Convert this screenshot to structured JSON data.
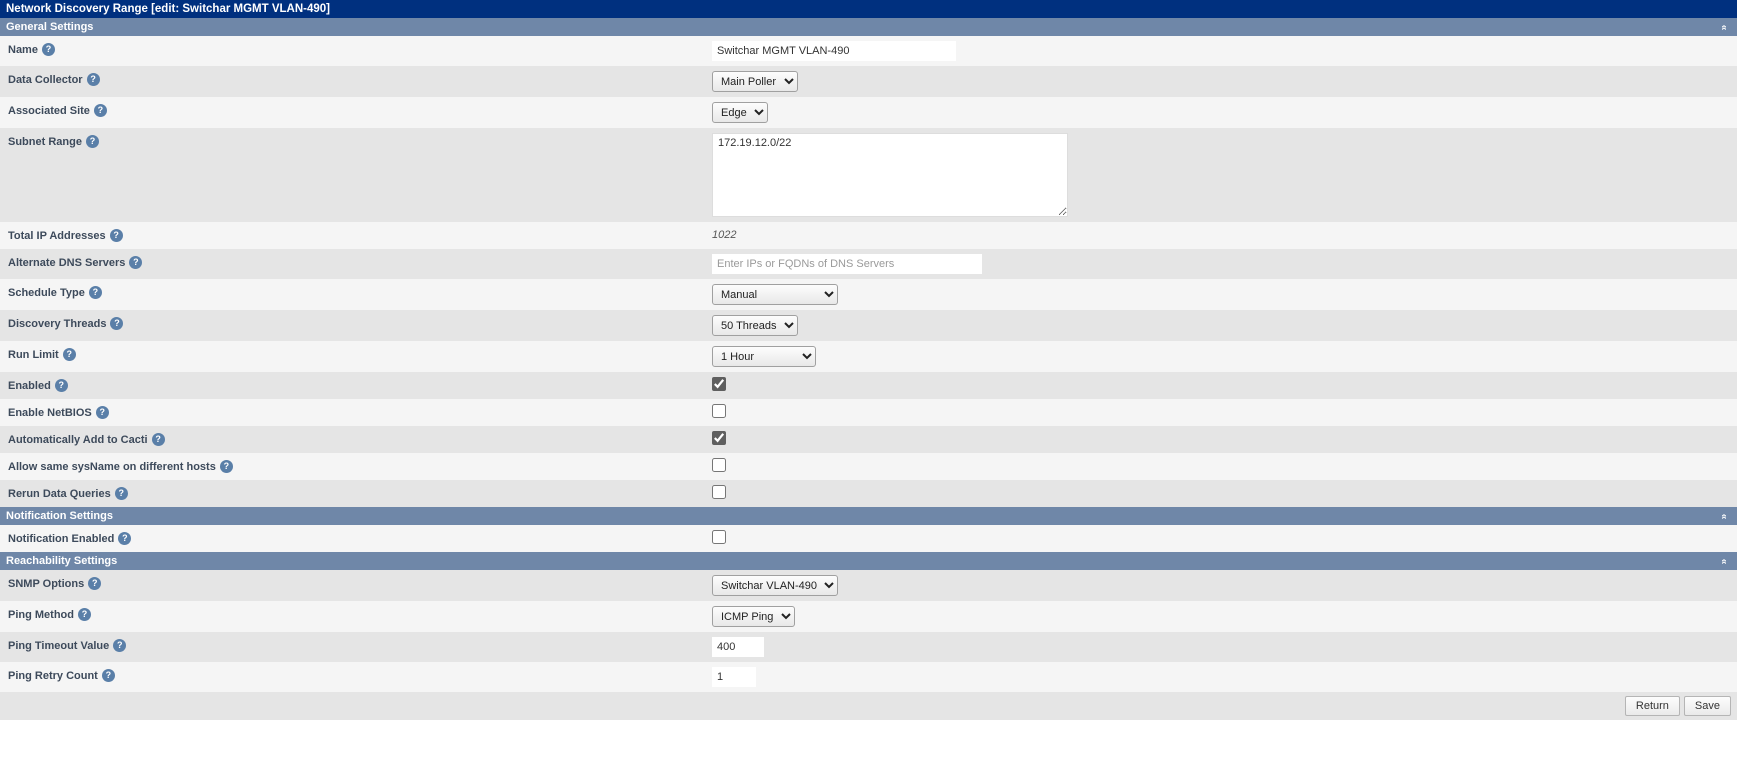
{
  "header": {
    "title": "Network Discovery Range [edit: Switchar MGMT VLAN-490]"
  },
  "sections": {
    "general": {
      "title": "General Settings",
      "fields": {
        "name": {
          "label": "Name",
          "value": "Switchar MGMT VLAN-490"
        },
        "data_collector": {
          "label": "Data Collector",
          "value": "Main Poller"
        },
        "associated_site": {
          "label": "Associated Site",
          "value": "Edge"
        },
        "subnet_range": {
          "label": "Subnet Range",
          "value": "172.19.12.0/22"
        },
        "total_ip": {
          "label": "Total IP Addresses",
          "value": "1022"
        },
        "alt_dns": {
          "label": "Alternate DNS Servers",
          "value": "",
          "placeholder": "Enter IPs or FQDNs of DNS Servers"
        },
        "schedule_type": {
          "label": "Schedule Type",
          "value": "Manual"
        },
        "discovery_threads": {
          "label": "Discovery Threads",
          "value": "50 Threads"
        },
        "run_limit": {
          "label": "Run Limit",
          "value": "1 Hour"
        },
        "enabled": {
          "label": "Enabled",
          "checked": true
        },
        "enable_netbios": {
          "label": "Enable NetBIOS",
          "checked": false
        },
        "auto_add": {
          "label": "Automatically Add to Cacti",
          "checked": true
        },
        "allow_sysname": {
          "label": "Allow same sysName on different hosts",
          "checked": false
        },
        "rerun_data": {
          "label": "Rerun Data Queries",
          "checked": false
        }
      }
    },
    "notification": {
      "title": "Notification Settings",
      "fields": {
        "notif_enabled": {
          "label": "Notification Enabled",
          "checked": false
        }
      }
    },
    "reachability": {
      "title": "Reachability Settings",
      "fields": {
        "snmp_options": {
          "label": "SNMP Options",
          "value": "Switchar VLAN-490"
        },
        "ping_method": {
          "label": "Ping Method",
          "value": "ICMP Ping"
        },
        "ping_timeout": {
          "label": "Ping Timeout Value",
          "value": "400"
        },
        "ping_retry": {
          "label": "Ping Retry Count",
          "value": "1"
        }
      }
    }
  },
  "footer": {
    "return": "Return",
    "save": "Save"
  },
  "icons": {
    "help": "?",
    "collapse": "«"
  }
}
